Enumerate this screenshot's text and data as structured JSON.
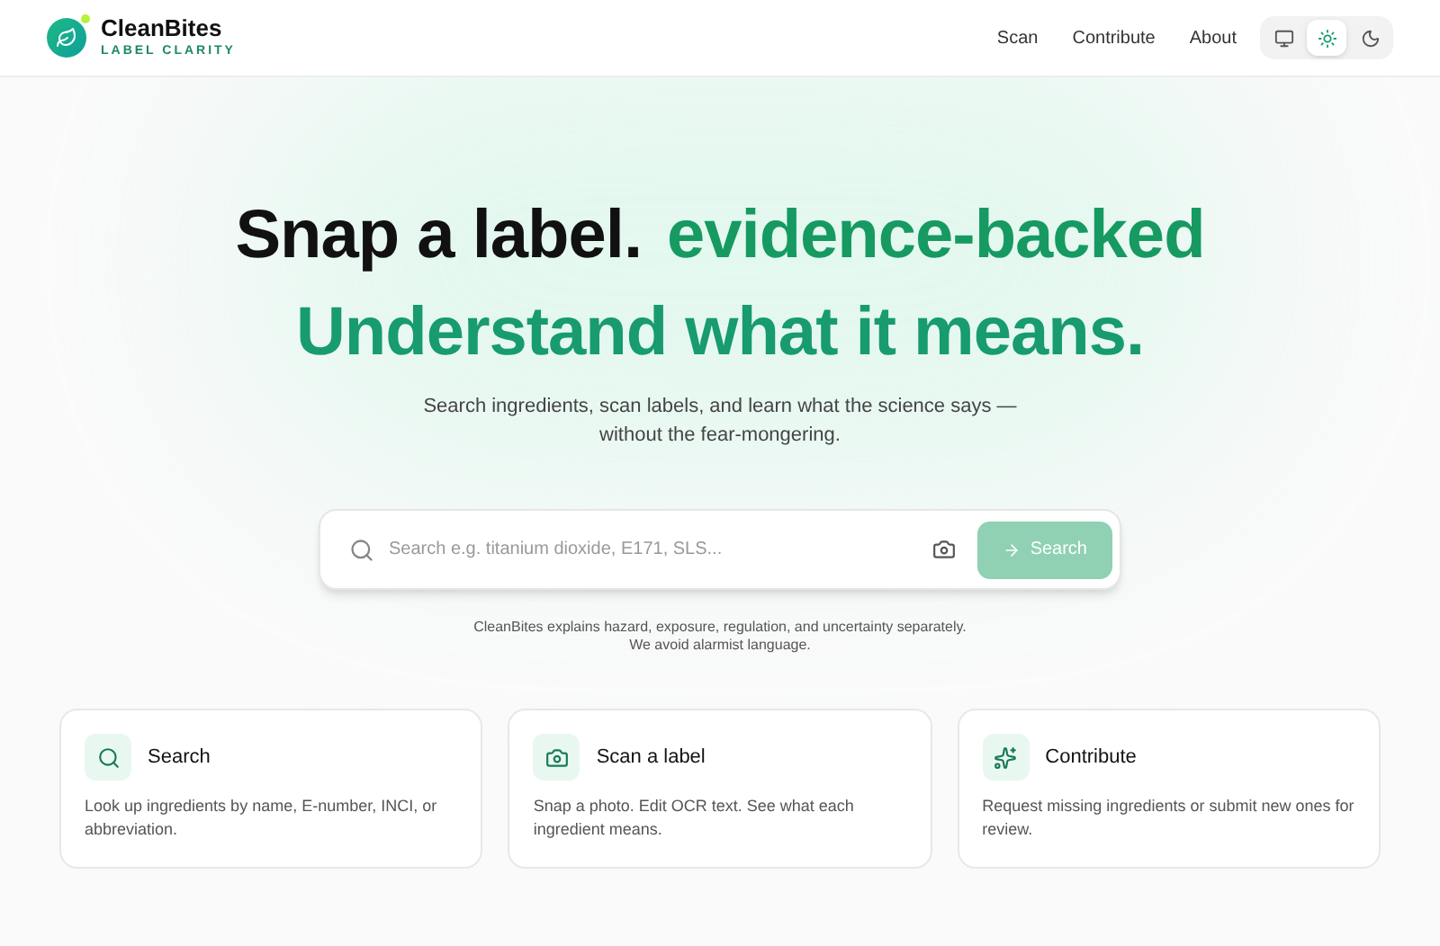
{
  "brand": {
    "name": "CleanBites",
    "tagline": "LABEL CLARITY"
  },
  "nav": [
    "Scan",
    "Contribute",
    "About"
  ],
  "theme_options": [
    {
      "kind": "system",
      "selected": false
    },
    {
      "kind": "light",
      "selected": true
    },
    {
      "kind": "dark",
      "selected": false
    }
  ],
  "hero": {
    "title_dark": "Snap a label.",
    "title_accent": "evidence-backed",
    "title_line2": "Understand what it means.",
    "subtitle_line1": "Search ingredients, scan labels, and learn what the science says —",
    "subtitle_line2": "without the fear-mongering."
  },
  "search": {
    "placeholder": "Search e.g. titanium dioxide, E171, SLS...",
    "button": "Search",
    "disabled": true
  },
  "disclaimer_line1": "CleanBites explains hazard, exposure, regulation, and uncertainty separately.",
  "disclaimer_line2": "We avoid alarmist language.",
  "cards": [
    {
      "kind": "search",
      "title": "Search",
      "text": "Look up ingredients by name, E-number, INCI, or abbreviation."
    },
    {
      "kind": "scan",
      "title": "Scan a label",
      "text": "Snap a photo. Edit OCR text. See what each ingredient means."
    },
    {
      "kind": "contribute",
      "title": "Contribute",
      "text": "Request missing ingredients or submit new ones for review."
    }
  ]
}
